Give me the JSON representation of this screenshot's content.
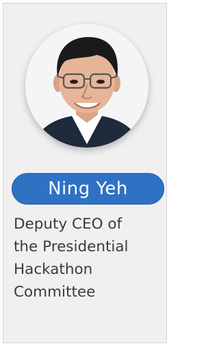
{
  "profile": {
    "name": "Ning Yeh",
    "title_lines": [
      "Deputy CEO of",
      "the Presidential",
      "Hackathon",
      "Committee"
    ]
  },
  "colors": {
    "card_background": "#f0f0f0",
    "name_badge": "#2f72c4",
    "name_text": "#ffffff",
    "title_text": "#3b3b3b"
  },
  "icons": {
    "avatar": "portrait-photo"
  }
}
